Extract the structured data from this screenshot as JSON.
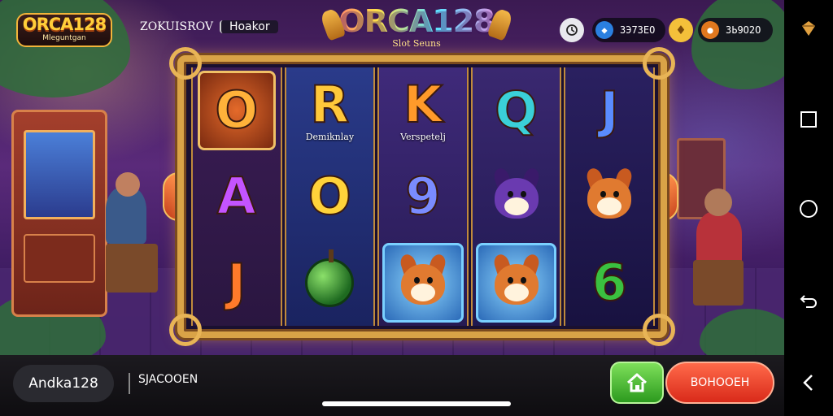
{
  "header": {
    "logo_left": {
      "title": "ORCA128",
      "subtitle": "Mleguntgan"
    },
    "site_label": "ZOKUISROV",
    "header_button": "Ноakor",
    "logo_center": {
      "title": "ORCA128",
      "subtitle": "Slot Seuns"
    },
    "balances": [
      {
        "icon": "blue-gem-icon",
        "value": "ЗЭ73ЕО"
      },
      {
        "icon": "gold-coin-icon",
        "value": "ЗЬ9О2О"
      }
    ]
  },
  "reels": [
    [
      {
        "symbol": "O",
        "color": "#ffb23a",
        "caption": ""
      },
      {
        "symbol": "A",
        "color": "#c454ff",
        "caption": ""
      },
      {
        "symbol": "J",
        "color": "#ff7a2a",
        "caption": ""
      }
    ],
    [
      {
        "symbol": "R",
        "color": "#ffc83a",
        "caption": "Demiknlay"
      },
      {
        "symbol": "O",
        "color": "#ffd23a",
        "caption": ""
      },
      {
        "symbol": "bomb",
        "color": "#4ac040",
        "caption": ""
      }
    ],
    [
      {
        "symbol": "K",
        "color": "#ff9a2a",
        "caption": "Verspetelj"
      },
      {
        "symbol": "9",
        "color": "#7a8cff",
        "caption": ""
      },
      {
        "symbol": "corgi",
        "color": "#e07a30",
        "caption": ""
      }
    ],
    [
      {
        "symbol": "Q",
        "color": "#3ad0d8",
        "caption": ""
      },
      {
        "symbol": "wolf",
        "color": "#6a3ab0",
        "caption": ""
      },
      {
        "symbol": "corgi",
        "color": "#e07a30",
        "caption": ""
      }
    ],
    [
      {
        "symbol": "J",
        "color": "#5a8cff",
        "caption": ""
      },
      {
        "symbol": "corgi",
        "color": "#e07a30",
        "caption": ""
      },
      {
        "symbol": "6",
        "color": "#3ac040",
        "caption": ""
      }
    ]
  ],
  "footer": {
    "username": "Andka128",
    "label": "SJACOOEN",
    "home_icon": "home-icon",
    "action_button": "ВОНООЕН"
  },
  "android_nav": [
    "gem-app-icon",
    "recents-icon",
    "home-circle-icon",
    "back-return-icon",
    "back-icon"
  ]
}
